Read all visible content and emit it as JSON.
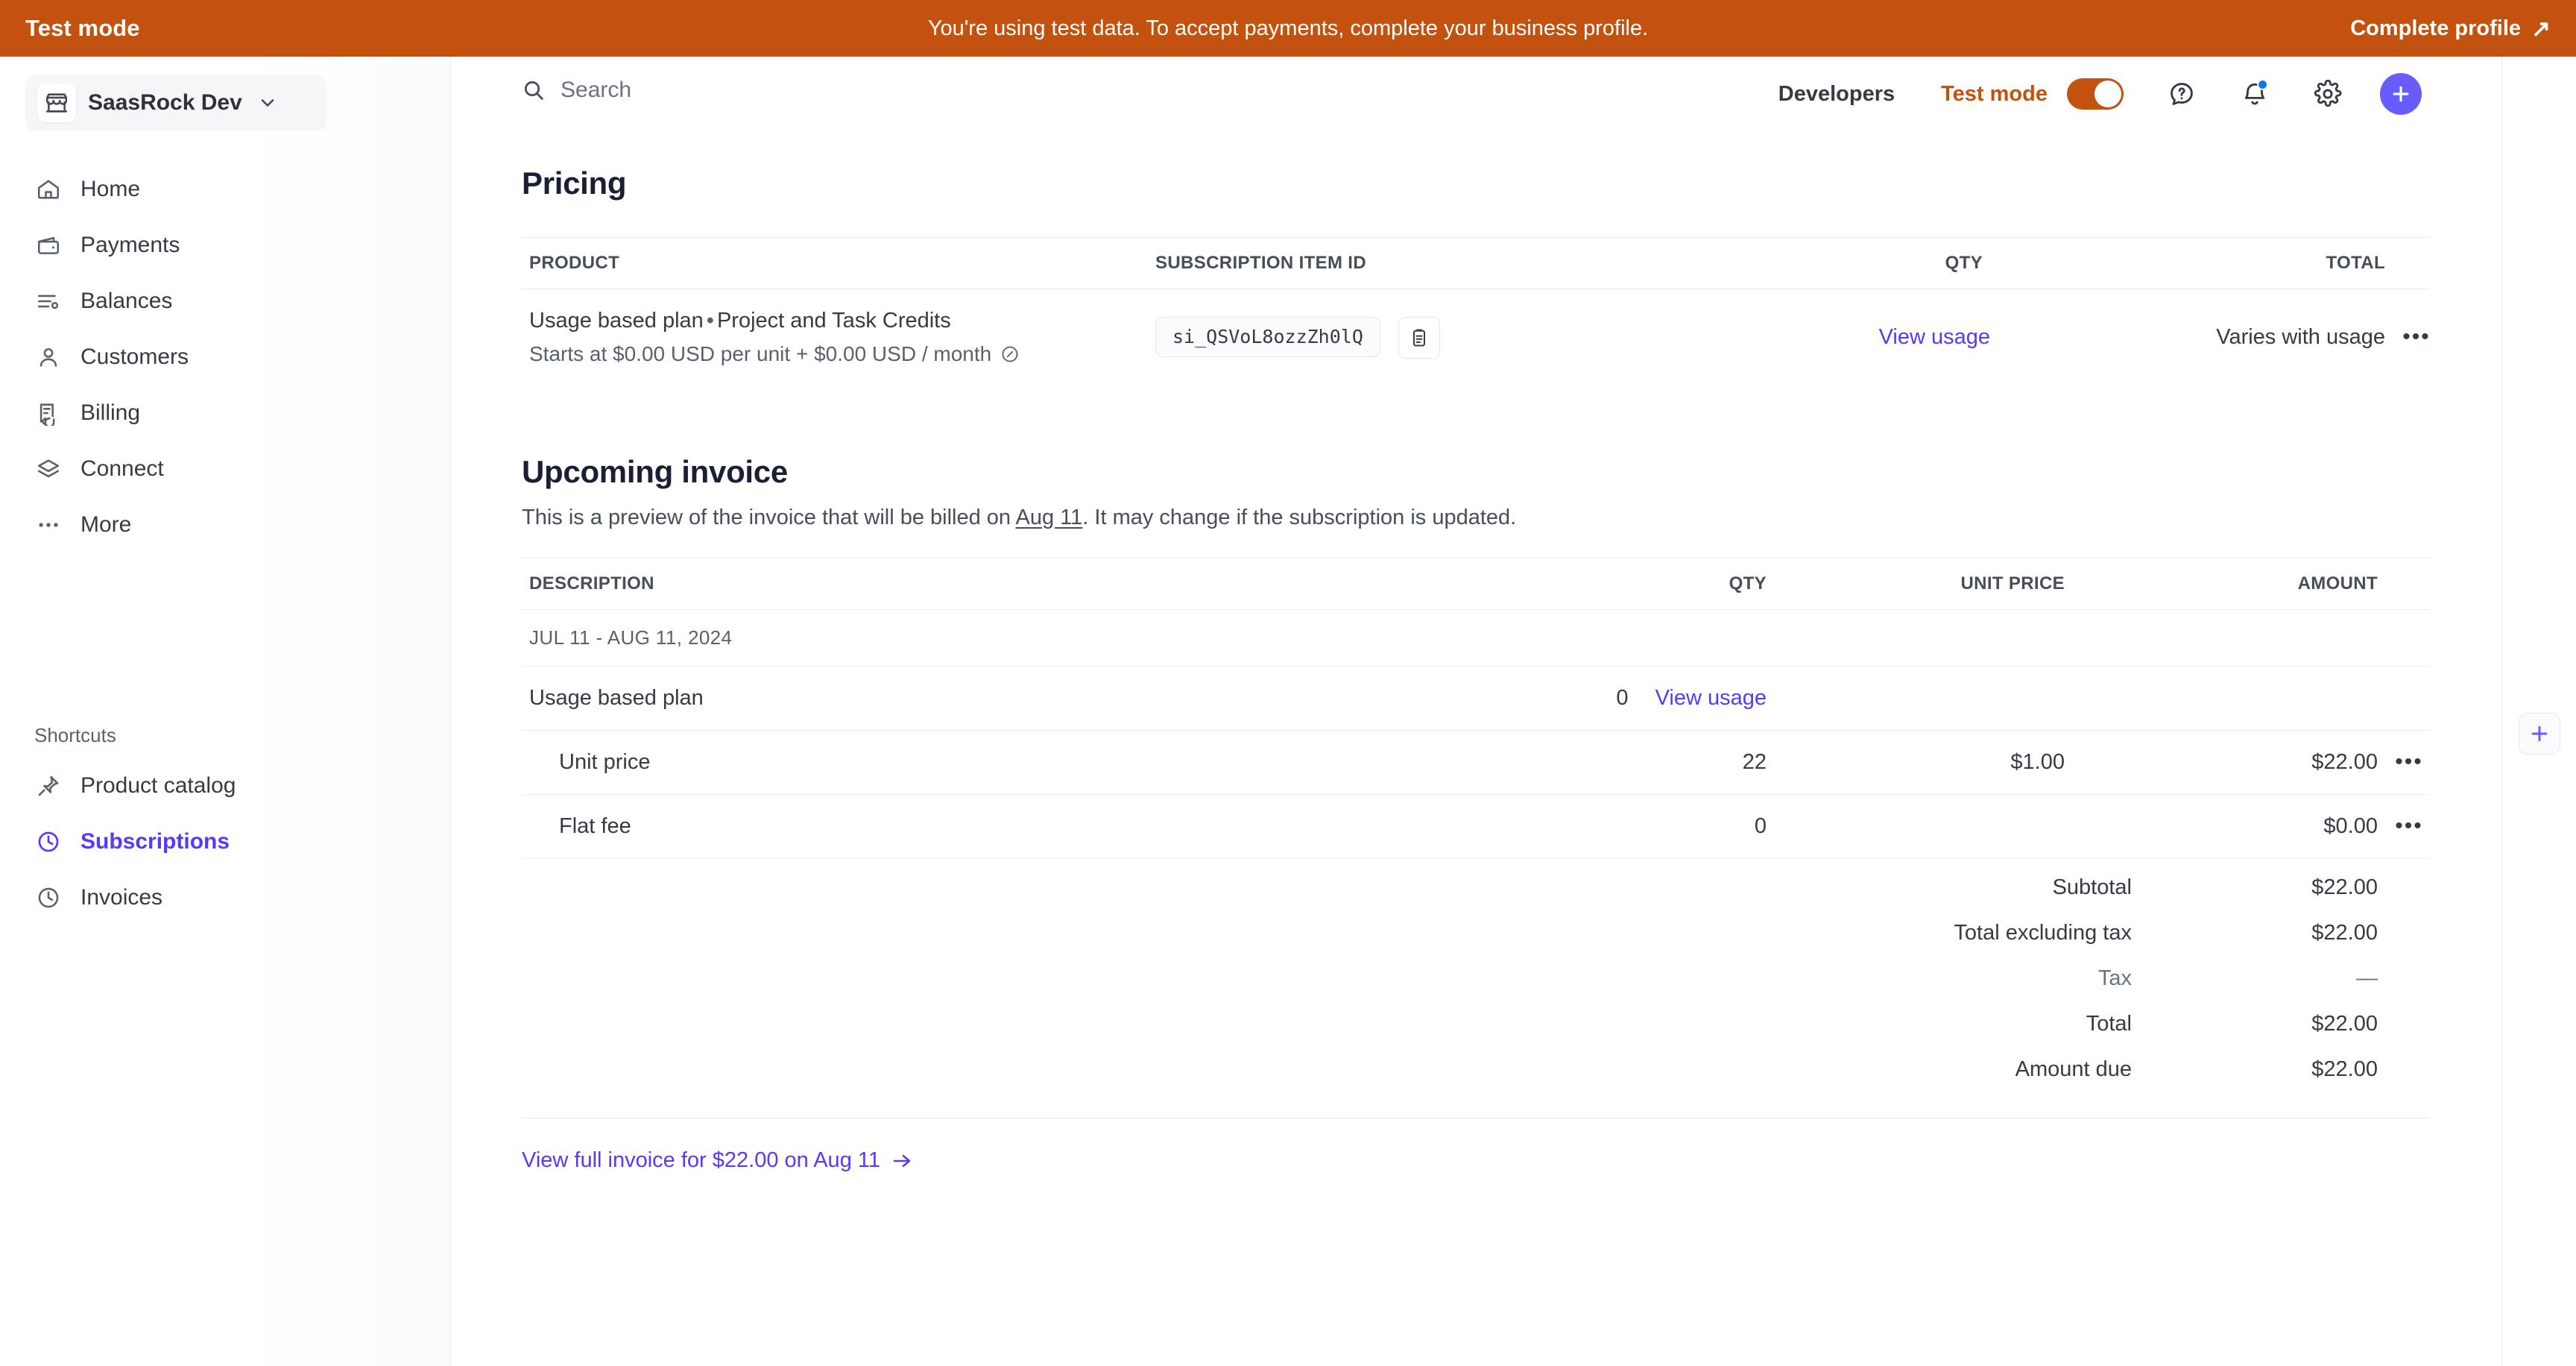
{
  "banner": {
    "left_label": "Test mode",
    "message": "You're using test data. To accept payments, complete your business profile.",
    "action_label": "Complete profile"
  },
  "sidebar": {
    "org_name": "SaasRock Dev",
    "nav": [
      {
        "label": "Home",
        "icon": "home-icon"
      },
      {
        "label": "Payments",
        "icon": "wallet-icon"
      },
      {
        "label": "Balances",
        "icon": "balances-icon"
      },
      {
        "label": "Customers",
        "icon": "person-icon"
      },
      {
        "label": "Billing",
        "icon": "billing-icon"
      },
      {
        "label": "Connect",
        "icon": "layers-icon"
      },
      {
        "label": "More",
        "icon": "ellipsis-icon"
      }
    ],
    "shortcuts_header": "Shortcuts",
    "shortcuts": [
      {
        "label": "Product catalog",
        "icon": "pin-icon",
        "active": false
      },
      {
        "label": "Subscriptions",
        "icon": "clock-icon",
        "active": true
      },
      {
        "label": "Invoices",
        "icon": "clock-icon",
        "active": false
      }
    ]
  },
  "topbar": {
    "search_placeholder": "Search",
    "developers_label": "Developers",
    "test_mode_label": "Test mode",
    "test_mode_on": true,
    "icons": [
      "help-icon",
      "notifications-icon",
      "settings-icon",
      "add-icon"
    ]
  },
  "pricing": {
    "title": "Pricing",
    "columns": {
      "product": "PRODUCT",
      "subscription_item_id": "SUBSCRIPTION ITEM ID",
      "qty": "QTY",
      "total": "TOTAL"
    },
    "row": {
      "product_plan": "Usage based plan",
      "product_separator": "•",
      "product_name": "Project and Task Credits",
      "price_description": "Starts at $0.00 USD per unit + $0.00 USD / month",
      "subscription_item_id": "si_QSVoL8ozzZh0lQ",
      "qty_link": "View usage",
      "total": "Varies with usage",
      "overflow": "•••"
    }
  },
  "upcoming_invoice": {
    "title": "Upcoming invoice",
    "description_prefix": "This is a preview of the invoice that will be billed on ",
    "description_link": "Aug 11",
    "description_suffix": ". It may change if the subscription is updated.",
    "columns": {
      "description": "DESCRIPTION",
      "qty": "QTY",
      "unit_price": "UNIT PRICE",
      "amount": "AMOUNT"
    },
    "period": "JUL 11 - AUG 11, 2024",
    "rows": [
      {
        "description": "Usage based plan",
        "qty": "0",
        "qty_link": "View usage",
        "unit_price": "",
        "amount": "",
        "overflow": ""
      },
      {
        "description": "Unit price",
        "qty": "22",
        "qty_link": "",
        "unit_price": "$1.00",
        "amount": "$22.00",
        "overflow": "•••"
      },
      {
        "description": "Flat fee",
        "qty": "0",
        "qty_link": "",
        "unit_price": "",
        "amount": "$0.00",
        "overflow": "•••"
      }
    ],
    "totals": [
      {
        "label": "Subtotal",
        "value": "$22.00",
        "muted": false
      },
      {
        "label": "Total excluding tax",
        "value": "$22.00",
        "muted": false
      },
      {
        "label": "Tax",
        "value": "—",
        "muted": true
      },
      {
        "label": "Total",
        "value": "$22.00",
        "muted": false
      },
      {
        "label": "Amount due",
        "value": "$22.00",
        "muted": false
      }
    ],
    "footer_link": "View full invoice for $22.00 on Aug 11"
  },
  "colors": {
    "test_mode_orange": "#C4520F",
    "brand_purple": "#533AFD",
    "accent_purple": "#675DFF",
    "text_dark": "#353a44",
    "text_muted": "#596171"
  }
}
